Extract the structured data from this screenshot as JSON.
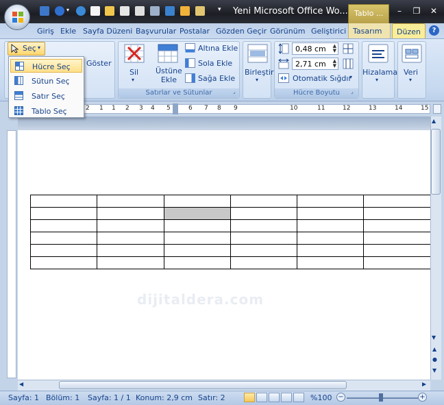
{
  "window": {
    "title": "Yeni Microsoft Office Wo...",
    "context_tab_header": "Tablo ...",
    "minimize": "–",
    "restore": "❐",
    "close": "✕"
  },
  "tabs": [
    {
      "label": "Giriş"
    },
    {
      "label": "Ekle"
    },
    {
      "label": "Sayfa Düzeni"
    },
    {
      "label": "Başvurular"
    },
    {
      "label": "Postalar"
    },
    {
      "label": "Gözden Geçir"
    },
    {
      "label": "Görünüm"
    },
    {
      "label": "Geliştirici"
    },
    {
      "label": "Tasarım"
    },
    {
      "label": "Düzen"
    }
  ],
  "ribbon": {
    "sec_label": "Seç",
    "goster_label": "Göster",
    "sil_label": "Sil",
    "ustune_ekle_label": "Üstüne\nEkle",
    "altina_ekle_label": "Altına Ekle",
    "sola_ekle_label": "Sola Ekle",
    "saga_ekle_label": "Sağa Ekle",
    "satirlar_group": "Satırlar ve Sütunlar",
    "birlestir_label": "Birleştir",
    "height_value": "0,48 cm",
    "width_value": "2,71 cm",
    "otomatik_sigdir": "Otomatik Sığdır",
    "hucre_boyutu_group": "Hücre Boyutu",
    "hizalama_label": "Hizalama",
    "veri_label": "Veri"
  },
  "dropdown": {
    "items": [
      {
        "label": "Hücre Seç"
      },
      {
        "label": "Sütun Seç"
      },
      {
        "label": "Satır Seç"
      },
      {
        "label": "Tablo Seç"
      }
    ]
  },
  "ruler": {
    "ticks": [
      "2",
      "1",
      "1",
      "2",
      "3",
      "4",
      "5",
      "6",
      "7",
      "8",
      "9",
      "10",
      "11",
      "12",
      "13",
      "14",
      "15"
    ]
  },
  "document": {
    "watermark": "dijitaldera.com"
  },
  "status": {
    "page": "Sayfa: 1",
    "section": "Bölüm: 1",
    "pages": "Sayfa: 1 / 1",
    "position": "Konum: 2,9 cm",
    "line": "Satır: 2",
    "zoom": "%100"
  }
}
